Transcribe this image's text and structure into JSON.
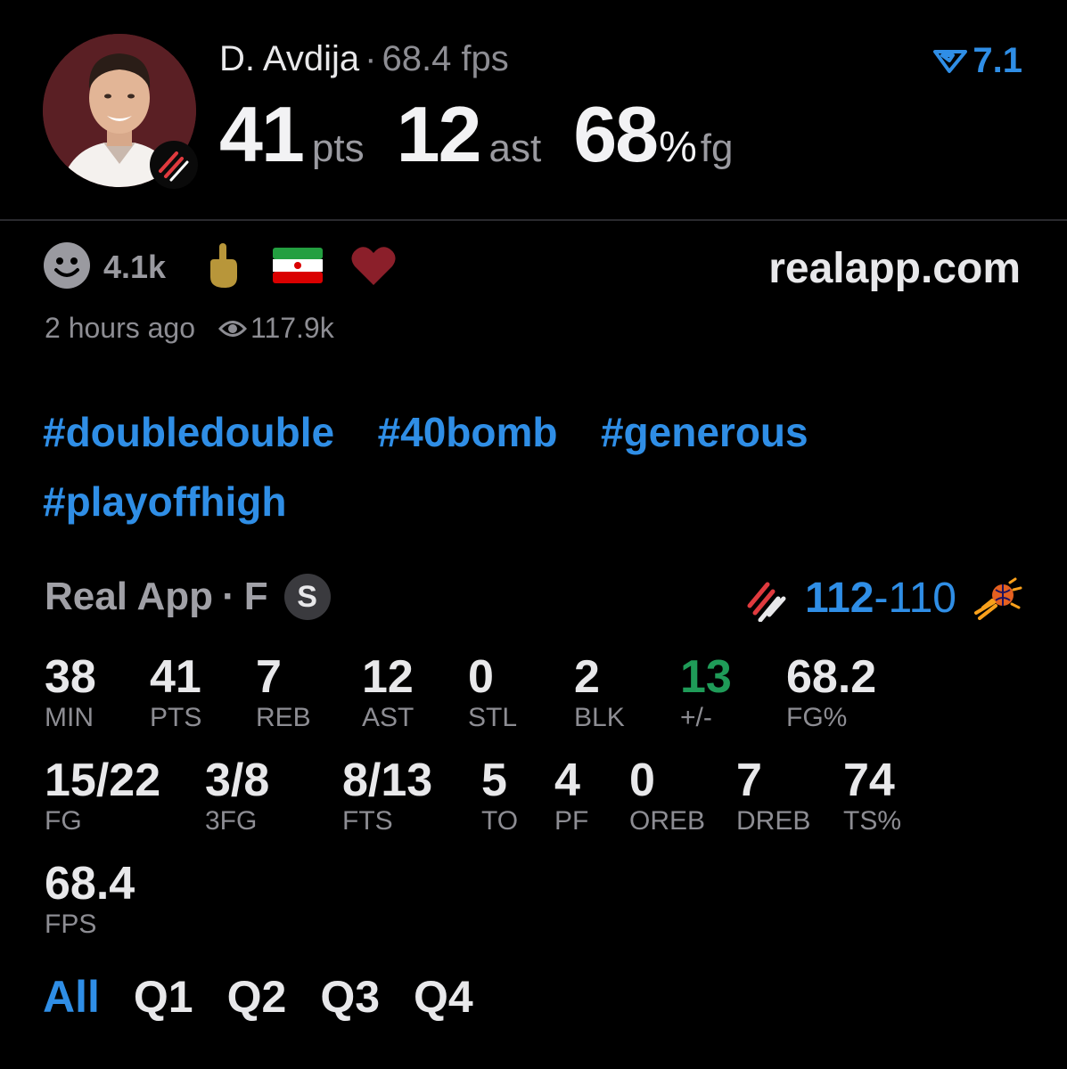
{
  "player": {
    "name": "D. Avdija",
    "fps": "68.4 fps",
    "rating": "7.1"
  },
  "headline": {
    "pts": "41",
    "pts_unit": "pts",
    "ast": "12",
    "ast_unit": "ast",
    "fg": "68",
    "fg_pct": "%",
    "fg_unit": "fg"
  },
  "reactions": {
    "count": "4.1k",
    "icons": [
      "smiley-icon",
      "middle-finger-emoji",
      "iran-flag-emoji",
      "heart-emoji"
    ],
    "site": "realapp.com",
    "time": "2 hours ago",
    "views": "117.9k"
  },
  "hashtags": [
    "#doubledouble",
    "#40bomb",
    "#generous",
    "#playoffhigh"
  ],
  "game": {
    "source": "Real App",
    "status": "F",
    "badge": "S",
    "home_score": "112",
    "dash": "-",
    "away_score": "110",
    "home_team_icon": "blazers-logo",
    "away_team_icon": "suns-logo"
  },
  "stats_row1": [
    {
      "value": "38",
      "label": "MIN"
    },
    {
      "value": "41",
      "label": "PTS"
    },
    {
      "value": "7",
      "label": "REB"
    },
    {
      "value": "12",
      "label": "AST"
    },
    {
      "value": "0",
      "label": "STL"
    },
    {
      "value": "2",
      "label": "BLK"
    },
    {
      "value": "13",
      "label": "+/-"
    },
    {
      "value": "68.2",
      "label": "FG%"
    }
  ],
  "stats_row2": [
    {
      "value": "15/22",
      "label": "FG"
    },
    {
      "value": "3/8",
      "label": "3FG"
    },
    {
      "value": "8/13",
      "label": "FTS"
    },
    {
      "value": "5",
      "label": "TO"
    },
    {
      "value": "4",
      "label": "PF"
    },
    {
      "value": "0",
      "label": "OREB"
    },
    {
      "value": "7",
      "label": "DREB"
    },
    {
      "value": "74",
      "label": "TS%"
    }
  ],
  "stats_row3": [
    {
      "value": "68.4",
      "label": "FPS"
    }
  ],
  "tabs": [
    "All",
    "Q1",
    "Q2",
    "Q3",
    "Q4"
  ],
  "colors": {
    "accent": "#2f8ee6",
    "positive": "#1f9b58",
    "background": "#000000"
  }
}
